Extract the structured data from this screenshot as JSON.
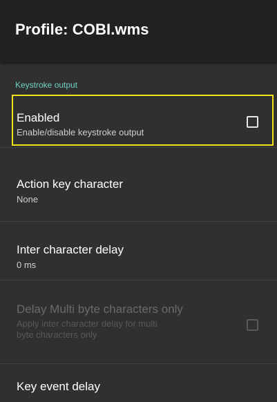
{
  "appbar": {
    "title": "Profile: COBI.wms"
  },
  "category": {
    "label": "Keystroke output"
  },
  "prefs": [
    {
      "title": "Enabled",
      "summary": "Enable/disable keystroke output",
      "checked": false,
      "enabled": true,
      "highlighted": true
    },
    {
      "title": "Action key character",
      "summary": "None",
      "enabled": true
    },
    {
      "title": "Inter character delay",
      "summary": "0 ms",
      "enabled": true
    },
    {
      "title": "Delay Multi byte characters only",
      "summary_line1": "Apply inter character delay for multi",
      "summary_line2": "byte characters only",
      "checked": false,
      "enabled": false
    },
    {
      "title": "Key event delay",
      "enabled": true
    }
  ],
  "colors": {
    "appbar_bg": "#212121",
    "content_bg": "#303030",
    "category_accent": "#6fd2c6",
    "highlight_outline": "#f5e11a"
  }
}
